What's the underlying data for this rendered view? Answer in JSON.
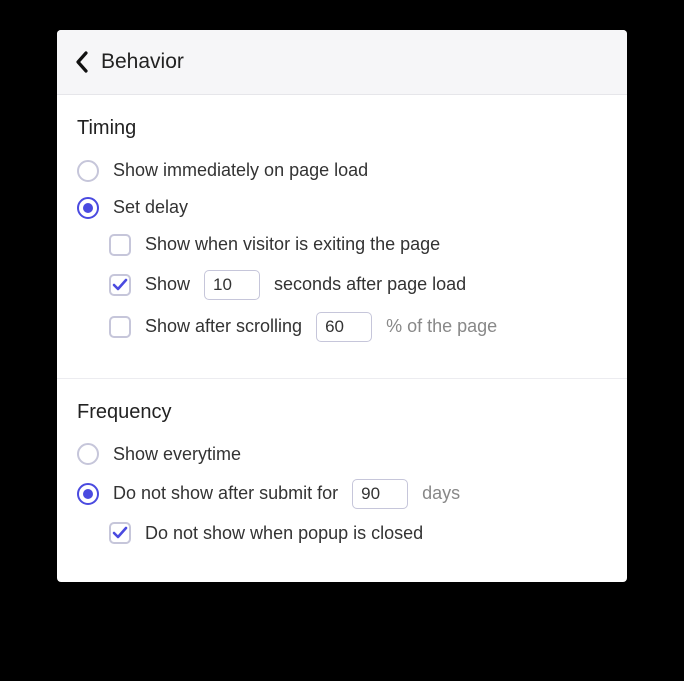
{
  "header": {
    "title": "Behavior"
  },
  "timing": {
    "title": "Timing",
    "opt_immediate": "Show immediately on page load",
    "opt_delay": "Set delay",
    "chk_exit": "Show when visitor is exiting the page",
    "chk_seconds_pre": "Show",
    "chk_seconds_post": "seconds after page load",
    "seconds_value": "10",
    "chk_scroll_pre": "Show after scrolling",
    "chk_scroll_post": "% of the page",
    "scroll_value": "60"
  },
  "frequency": {
    "title": "Frequency",
    "opt_everytime": "Show everytime",
    "opt_submit_pre": "Do not show after submit for",
    "opt_submit_post": "days",
    "submit_value": "90",
    "chk_closed": "Do not show when popup is closed"
  }
}
